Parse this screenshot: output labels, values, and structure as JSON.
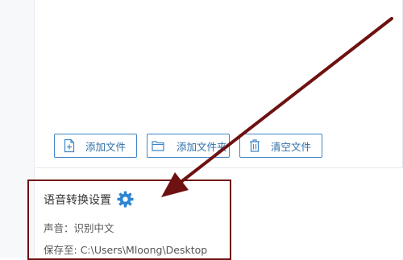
{
  "toolbar": {
    "add_file_label": "添加文件",
    "add_folder_label": "添加文件夹",
    "clear_label": "清空文件"
  },
  "settings": {
    "title": "语音转换设置",
    "voice_label": "声音：",
    "voice_value": "识别中文",
    "save_label": "保存至: ",
    "save_path": "C:\\Users\\Mloong\\Desktop"
  },
  "colors": {
    "accent": "#2f6fa8",
    "button_border": "#3f86c7",
    "gear": "#2b86d4",
    "annotation": "#6e1111"
  },
  "icons": {
    "add_file": "file-plus-icon",
    "add_folder": "folder-icon",
    "clear": "trash-icon",
    "settings": "gear-icon",
    "annotation": "arrow-icon"
  }
}
